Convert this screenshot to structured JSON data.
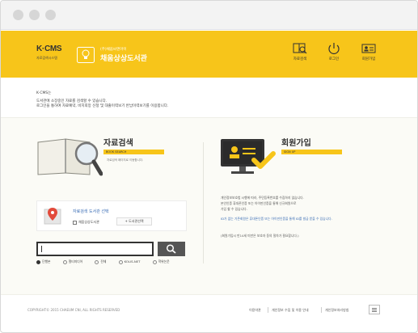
{
  "header": {
    "logo_main": "K·CMS",
    "logo_sub": "자료검색시스템",
    "library_small": "(주)채움씨엔아이",
    "library_name": "채움상상도서관",
    "brand_color": "#f7c51a",
    "nav": [
      {
        "label": "자료검색",
        "icon": "book-search-icon"
      },
      {
        "label": "로그인",
        "icon": "power-icon"
      },
      {
        "label": "회원가입",
        "icon": "id-card-icon"
      }
    ]
  },
  "intro": {
    "heading": "K·CMS는",
    "line1": "도서관에 소장중인 자료를 검색할 수 있습니다.",
    "line2": "로그인을 통하여 자료예약, 비치희망 신청 및 대출이력보기 반납이력보기를 이용합니다."
  },
  "search_section": {
    "title": "자료검색",
    "tag": "BOOK SEARCH",
    "desc": "자료검색 페이지로 이동합니다.",
    "location_title": "자료검색 도서관 선택",
    "location_checkbox": "채움상상도서관",
    "location_button": "+ 도서관선택",
    "input_value": "",
    "options": [
      "단행본",
      "멀티미디어",
      "전체",
      "KOLIS-NET",
      "학위논문"
    ],
    "selected_option": "단행본"
  },
  "member_section": {
    "title": "회원가입",
    "tag": "SIGN UP",
    "notes": [
      "개인정보보호법 시행에 따라, 주민등록번호를 수집하지 않습니다.",
      "본인인증 휴대폰인증 또는 아이핀인증을 통해 신규회원으로",
      "가입 할 수 있습니다.",
      "ID가 없는 기존회원은 휴대폰인증 또는 아이핀인증을 통해 ID를 발급 받을 수 있습니다.",
      "(회원가입시 만14세 미만은 보호자 동의 절차가 필요합니다.)"
    ]
  },
  "footer": {
    "copyright": "COPYRIGHT© 2015 CHAEUM CNI, ALL RIGHTS RESERVED",
    "links": [
      "이용약관",
      "개인정보 수집 및 이용 안내",
      "개인정보처리방침"
    ]
  }
}
